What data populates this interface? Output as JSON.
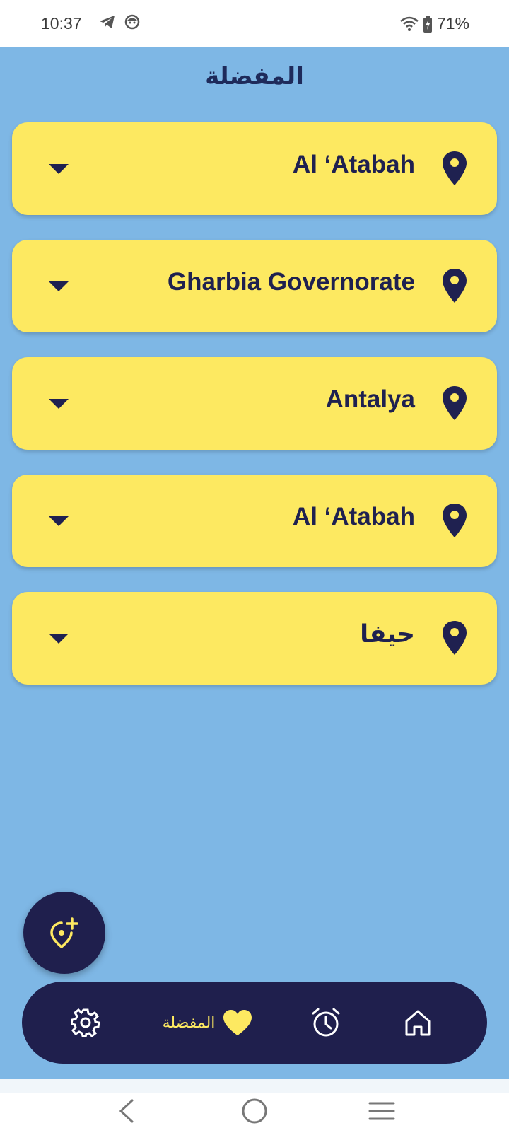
{
  "status_bar": {
    "time": "10:37",
    "battery": "71%"
  },
  "page": {
    "title": "المفضلة"
  },
  "favorites": [
    {
      "name": "Al ‘Atabah"
    },
    {
      "name": "Gharbia Governorate"
    },
    {
      "name": "Antalya"
    },
    {
      "name": "Al ‘Atabah"
    },
    {
      "name": "حيفا"
    }
  ],
  "bottom_nav": {
    "favorites_label": "المفضلة"
  },
  "colors": {
    "background": "#7eb7e5",
    "card": "#fde961",
    "navy": "#1f1f4d",
    "accent": "#fde961"
  }
}
